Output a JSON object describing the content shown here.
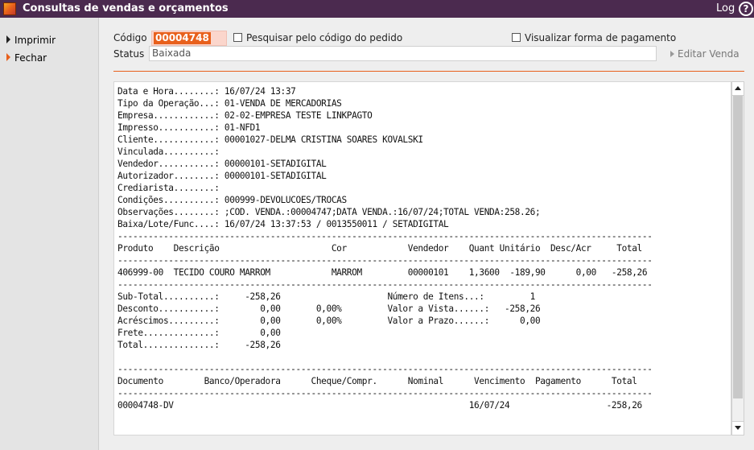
{
  "window": {
    "title": "Consultas de vendas e orçamentos",
    "log_label": "Log",
    "help_glyph": "?"
  },
  "sidebar": {
    "items": [
      {
        "label": "Imprimir"
      },
      {
        "label": "Fechar"
      }
    ]
  },
  "form": {
    "codigo_label": "Código",
    "codigo_value": "00004748",
    "search_by_order_label": "Pesquisar pelo código do pedido",
    "search_by_order_checked": false,
    "show_payment_label": "Visualizar forma de pagamento",
    "show_payment_checked": false,
    "status_label": "Status",
    "status_value": "Baixada",
    "edit_sale_label": "Editar Venda"
  },
  "report": {
    "lines": [
      "Data e Hora........: 16/07/24 13:37",
      "Tipo da Operação...: 01-VENDA DE MERCADORIAS",
      "Empresa............: 02-02-EMPRESA TESTE LINKPAGTO",
      "Impresso...........: 01-NFD1",
      "Cliente............: 00001027-DELMA CRISTINA SOARES KOVALSKI",
      "Vinculada..........:",
      "Vendedor...........: 00000101-SETADIGITAL",
      "Autorizador........: 00000101-SETADIGITAL",
      "Crediarista........:",
      "Condições..........: 000999-DEVOLUCOES/TROCAS",
      "Observações........: ;COD. VENDA.:00004747;DATA VENDA.:16/07/24;TOTAL VENDA:258.26;",
      "Baixa/Lote/Func....: 16/07/24 13:37:53 / 0013550011 / SETADIGITAL",
      "---------------------------------------------------------------------------------------------------------",
      "Produto    Descrição                      Cor            Vendedor    Quant Unitário  Desc/Acr     Total",
      "---------------------------------------------------------------------------------------------------------",
      "406999-00  TECIDO COURO MARROM            MARROM         00000101    1,3600  -189,90      0,00   -258,26",
      "---------------------------------------------------------------------------------------------------------",
      "Sub-Total..........:     -258,26                     Número de Itens...:         1",
      "Desconto...........:        0,00       0,00%         Valor a Vista......:   -258,26",
      "Acréscimos.........:        0,00       0,00%         Valor a Prazo......:      0,00",
      "Frete..............:        0,00",
      "Total..............:     -258,26",
      "",
      "---------------------------------------------------------------------------------------------------------",
      "Documento        Banco/Operadora      Cheque/Compr.      Nominal      Vencimento  Pagamento      Total",
      "---------------------------------------------------------------------------------------------------------",
      "00004748-DV                                                          16/07/24                   -258,26"
    ]
  }
}
